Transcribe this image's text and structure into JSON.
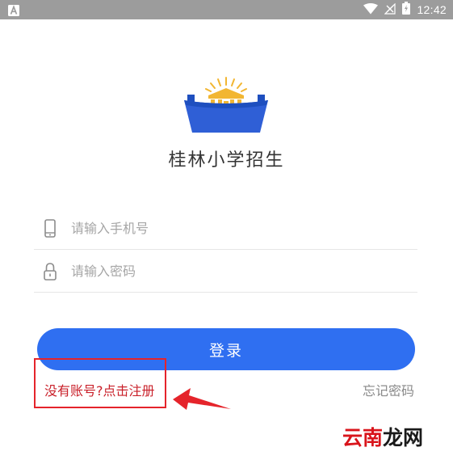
{
  "status_bar": {
    "time": "12:42",
    "left_icon": "a-notification-icon",
    "icons": [
      "wifi-icon",
      "no-signal-icon",
      "battery-charging-icon"
    ]
  },
  "app": {
    "title": "桂林小学招生",
    "logo_icon": "school-building-sunrise-logo"
  },
  "form": {
    "phone": {
      "placeholder": "请输入手机号",
      "value": "",
      "icon": "phone-icon"
    },
    "password": {
      "placeholder": "请输入密码",
      "value": "",
      "icon": "lock-icon"
    },
    "login_label": "登录",
    "register_label": "没有账号?点击注册",
    "forgot_label": "忘记密码"
  },
  "annotation": {
    "color": "#e5242b",
    "arrow_icon": "arrow-left-icon"
  },
  "watermark": {
    "text": "云南龙网",
    "colors": {
      "yun": "#d9141b",
      "nan": "#d9141b",
      "long": "#1a1a1a",
      "wang": "#1a1a1a"
    }
  },
  "colors": {
    "primary": "#2f6ff1",
    "register_text": "#c9202a",
    "status_bar": "#9c9c9c"
  }
}
